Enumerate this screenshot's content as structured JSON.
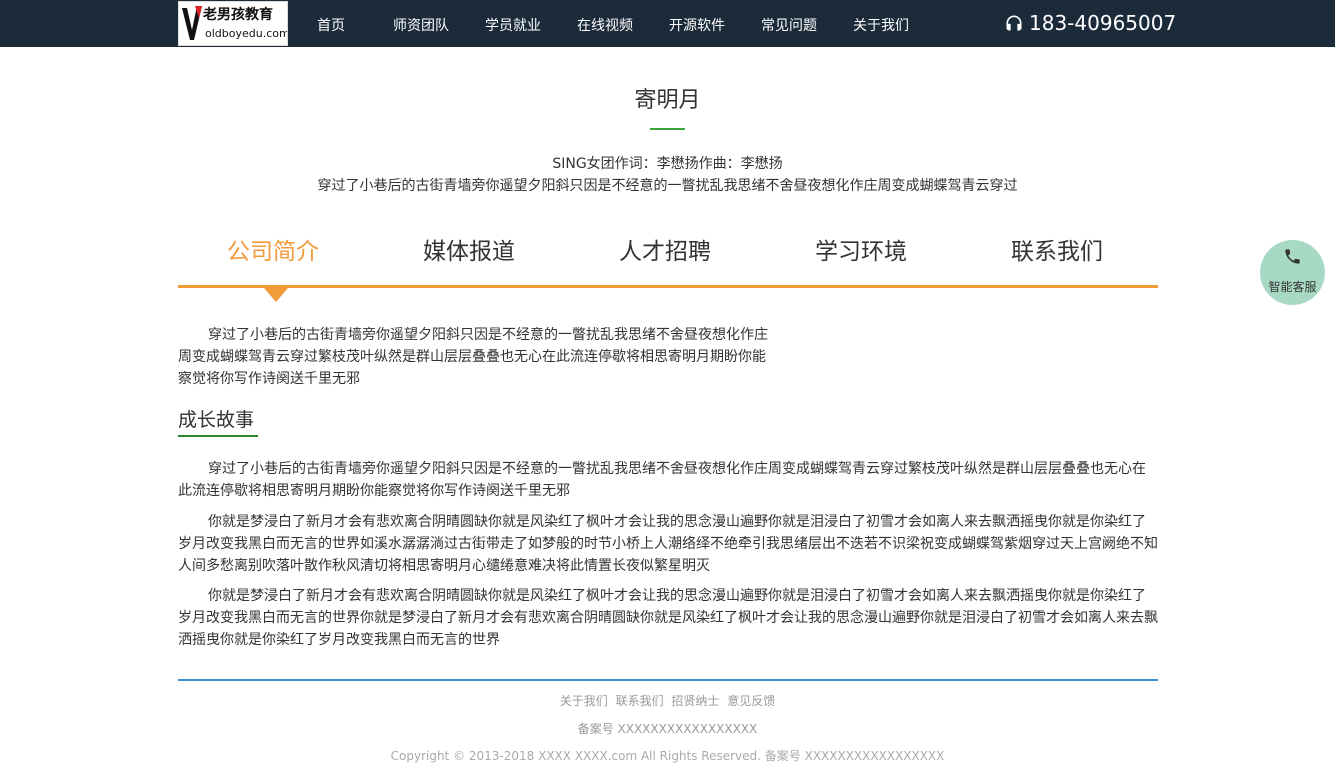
{
  "header": {
    "logo_text_cn": "老男孩教育",
    "logo_text_en": "oldboyedu.com",
    "nav": [
      {
        "label": "首页"
      },
      {
        "label": "师资团队"
      },
      {
        "label": "学员就业"
      },
      {
        "label": "在线视频"
      },
      {
        "label": "开源软件"
      },
      {
        "label": "常见问题"
      },
      {
        "label": "关于我们"
      }
    ],
    "phone": "183-40965007"
  },
  "article": {
    "title": "寄明月",
    "credit": "SING女团作词：李懋扬作曲：李懋扬",
    "summary": "穿过了小巷后的古街青墙旁你遥望夕阳斜只因是不经意的一瞥扰乱我思绪不舍昼夜想化作庄周变成蝴蝶驾青云穿过"
  },
  "tabs": [
    {
      "label": "公司简介",
      "active": true
    },
    {
      "label": "媒体报道",
      "active": false
    },
    {
      "label": "人才招聘",
      "active": false
    },
    {
      "label": "学习环境",
      "active": false
    },
    {
      "label": "联系我们",
      "active": false
    }
  ],
  "intro": "穿过了小巷后的古街青墙旁你遥望夕阳斜只因是不经意的一瞥扰乱我思绪不舍昼夜想化作庄周变成蝴蝶驾青云穿过繁枝茂叶纵然是群山层层叠叠也无心在此流连停歇将相思寄明月期盼你能察觉将你写作诗阕送千里无邪",
  "growth": {
    "title": "成长故事",
    "paragraphs": [
      "穿过了小巷后的古街青墙旁你遥望夕阳斜只因是不经意的一瞥扰乱我思绪不舍昼夜想化作庄周变成蝴蝶驾青云穿过繁枝茂叶纵然是群山层层叠叠也无心在此流连停歇将相思寄明月期盼你能察觉将你写作诗阕送千里无邪",
      "你就是梦浸白了新月才会有悲欢离合阴晴圆缺你就是风染红了枫叶才会让我的思念漫山遍野你就是泪浸白了初雪才会如离人来去飘洒摇曳你就是你染红了岁月改变我黑白而无言的世界如溪水潺潺淌过古街带走了如梦般的时节小桥上人潮络绎不绝牵引我思绪层出不迭若不识梁祝变成蝴蝶驾紫烟穿过天上宫阙绝不知人间多愁离别吹落叶散作秋风清切将相思寄明月心缱绻意难决将此情置长夜似繁星明灭",
      "你就是梦浸白了新月才会有悲欢离合阴晴圆缺你就是风染红了枫叶才会让我的思念漫山遍野你就是泪浸白了初雪才会如离人来去飘洒摇曳你就是你染红了岁月改变我黑白而无言的世界你就是梦浸白了新月才会有悲欢离合阴晴圆缺你就是风染红了枫叶才会让我的思念漫山遍野你就是泪浸白了初雪才会如离人来去飘洒摇曳你就是你染红了岁月改变我黑白而无言的世界"
    ]
  },
  "footer": {
    "links": [
      {
        "label": "关于我们"
      },
      {
        "label": "联系我们"
      },
      {
        "label": "招贤纳士"
      },
      {
        "label": "意见反馈"
      }
    ],
    "beian": "备案号 XXXXXXXXXXXXXXXXX",
    "copyright": "Copyright © 2013-2018 XXXX XXXX.com All Rights Reserved. 备案号 XXXXXXXXXXXXXXXXX"
  },
  "service": {
    "label": "智能客服",
    "icon": "phone-icon",
    "color": "#a8d9c4"
  },
  "colors": {
    "header_bg": "#1c2b3a",
    "accent_orange": "#f29b3b",
    "accent_green": "#3aa63a",
    "footer_line": "#3d8fd1"
  }
}
